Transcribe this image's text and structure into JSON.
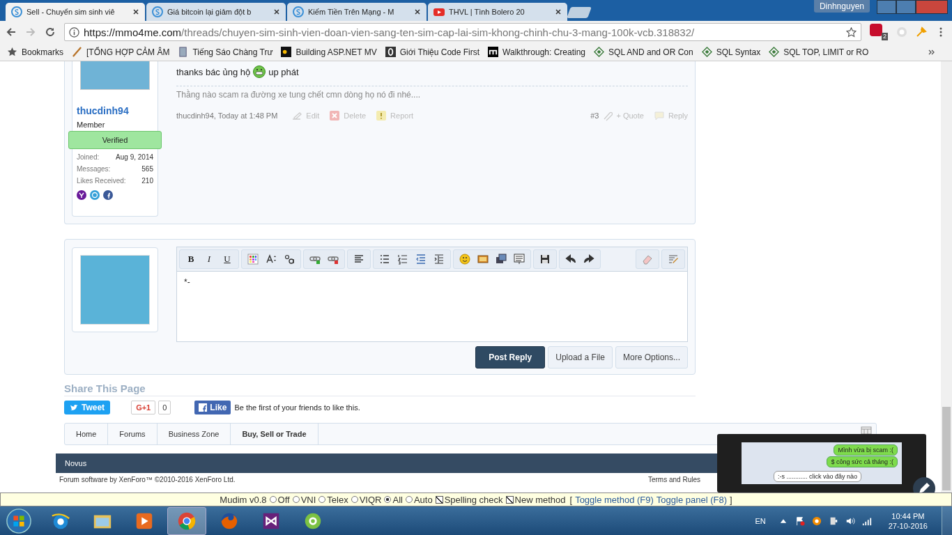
{
  "browser": {
    "tabs": [
      {
        "title": "Sell - Chuyển sim sinh viê",
        "selected": true
      },
      {
        "title": "Giá bitcoin lại giảm đột b",
        "selected": false
      },
      {
        "title": "Kiếm Tiền Trên Mạng - M",
        "selected": false
      },
      {
        "title": "THVL | Tình Bolero 20",
        "selected": false
      }
    ],
    "user": "Dinhnguyen",
    "url_host": "https://mmo4me.com",
    "url_path": "/threads/chuyen-sim-sinh-vien-doan-vien-sang-ten-sim-cap-lai-sim-khong-chinh-chu-3-mang-100k-vcb.318832/",
    "extension_badge": "2",
    "bookmarks": [
      "Bookmarks",
      "[TỔNG HỢP CẢM ÂM",
      "Tiếng Sáo Chàng Trư",
      "Building ASP.NET MV",
      "Giới Thiệu Code First",
      "Walkthrough: Creating",
      "SQL AND and OR Con",
      "SQL Syntax",
      "SQL TOP, LIMIT or RO"
    ]
  },
  "post": {
    "username": "thucdinh94",
    "role": "Member",
    "badge": "Verified",
    "stats": [
      {
        "label": "Joined:",
        "value": "Aug 9, 2014"
      },
      {
        "label": "Messages:",
        "value": "565"
      },
      {
        "label": "Likes Received:",
        "value": "210"
      }
    ],
    "message_before": "thanks bác ủng hộ",
    "message_after": "up phát",
    "signature": "Thằng nào scam ra đường xe tung chết cmn dòng họ nó đi nhé....",
    "author_time": "thucdinh94, Today at 1:48 PM",
    "actions": [
      "Edit",
      "Delete",
      "Report"
    ],
    "number": "#3",
    "quote": "+ Quote",
    "reply": "Reply"
  },
  "editor": {
    "format_buttons": [
      "B",
      "I",
      "U"
    ],
    "content": "*-",
    "buttons": [
      {
        "label": "Post Reply",
        "kind": "primary"
      },
      {
        "label": "Upload a File",
        "kind": "plain"
      },
      {
        "label": "More Options...",
        "kind": "plain"
      }
    ]
  },
  "share": {
    "heading": "Share This Page",
    "tweet": "Tweet",
    "gplus": "G+1",
    "gplus_count": "0",
    "like": "Like",
    "like_text": "Be the first of your friends to like this."
  },
  "breadcrumb": [
    {
      "label": "Home",
      "selected": false
    },
    {
      "label": "Forums",
      "selected": false
    },
    {
      "label": "Business Zone",
      "selected": false
    },
    {
      "label": "Buy, Sell or Trade",
      "selected": true
    }
  ],
  "footer": {
    "style": "Novus",
    "copyright": "Forum software by XenForo™ ©2010-2016 XenForo Ltd.",
    "terms": "Terms and Rules"
  },
  "popup": {
    "bubbles": [
      "Mình vừa bị scam :(",
      "$ công sức cả tháng :(",
      ":-s ............ click vào đây nào"
    ]
  },
  "mudim": {
    "title": "Mudim v0.8",
    "options": [
      {
        "label": "Off",
        "selected": false
      },
      {
        "label": "VNI",
        "selected": false
      },
      {
        "label": "Telex",
        "selected": false
      },
      {
        "label": "VIQR",
        "selected": false
      },
      {
        "label": "All",
        "selected": true
      },
      {
        "label": "Auto",
        "selected": false
      }
    ],
    "checks": [
      {
        "label": "Spelling check",
        "checked": true
      },
      {
        "label": "New method",
        "checked": true
      }
    ],
    "open": "[",
    "links": [
      "Toggle method (F9)",
      "Toggle panel (F8)"
    ],
    "close": "]"
  },
  "taskbar": {
    "apps": [
      {
        "kind": "ie",
        "selected": false
      },
      {
        "kind": "folder",
        "selected": false
      },
      {
        "kind": "media",
        "selected": false
      },
      {
        "kind": "chrome",
        "selected": true
      },
      {
        "kind": "firefox",
        "selected": false
      },
      {
        "kind": "vs",
        "selected": false
      },
      {
        "kind": "coccoc",
        "selected": false
      }
    ],
    "language": "EN",
    "time": "10:44 PM",
    "date": "27-10-2016"
  }
}
